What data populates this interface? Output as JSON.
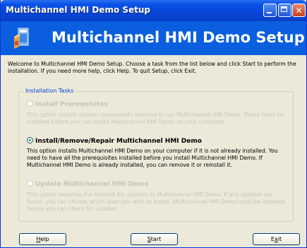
{
  "window": {
    "title": "Multichannel HMI Demo Setup"
  },
  "header": {
    "title": "Multichannel HMI Demo Setup"
  },
  "intro": "Welcome to Multichannel HMI Demo Setup. Choose a task from the list below and click Start to perform the installation. If you need more help, click Help. To quit Setup, click Exit.",
  "group": {
    "legend": "Installation Tasks"
  },
  "options": [
    {
      "label": "Install Prerequisites",
      "enabled": false,
      "selected": false,
      "desc": "This option installs system components required to run Multichannel HMI Demo. These must be installed before you can install Multichannel HMI Demo on your computer."
    },
    {
      "label": "Install/Remove/Repair Multichannel HMI Demo",
      "enabled": true,
      "selected": true,
      "desc": "This option installs Multichannel HMI Demo on your computer if it is not already installed. You need to have all the prerequisites installed before you install Multichannel HMI Demo. If Multichannel HMI Demo is already installed, you can remove it or reinstall it."
    },
    {
      "label": "Update Multichannel HMI Demo",
      "enabled": false,
      "selected": false,
      "desc": "This option searches the Internet for updates to Multichannel HMI Demo. If any updates are found, you can choose which ones you wish to install. Multichannel HMI Demo must be installed before you can check for updates."
    }
  ],
  "buttons": {
    "help": {
      "accel": "H",
      "rest": "elp"
    },
    "start": {
      "accel": "S",
      "rest": "tart"
    },
    "exit": {
      "pre": "E",
      "accel": "x",
      "rest": "it"
    }
  },
  "icons": {
    "setup": "setup-box-icon",
    "minimize": "minimize-icon",
    "maximize": "maximize-icon",
    "close": "close-icon"
  },
  "colors": {
    "titlebar": "#0a52e6",
    "header": "#0b5fde",
    "legend": "#0046d5"
  }
}
